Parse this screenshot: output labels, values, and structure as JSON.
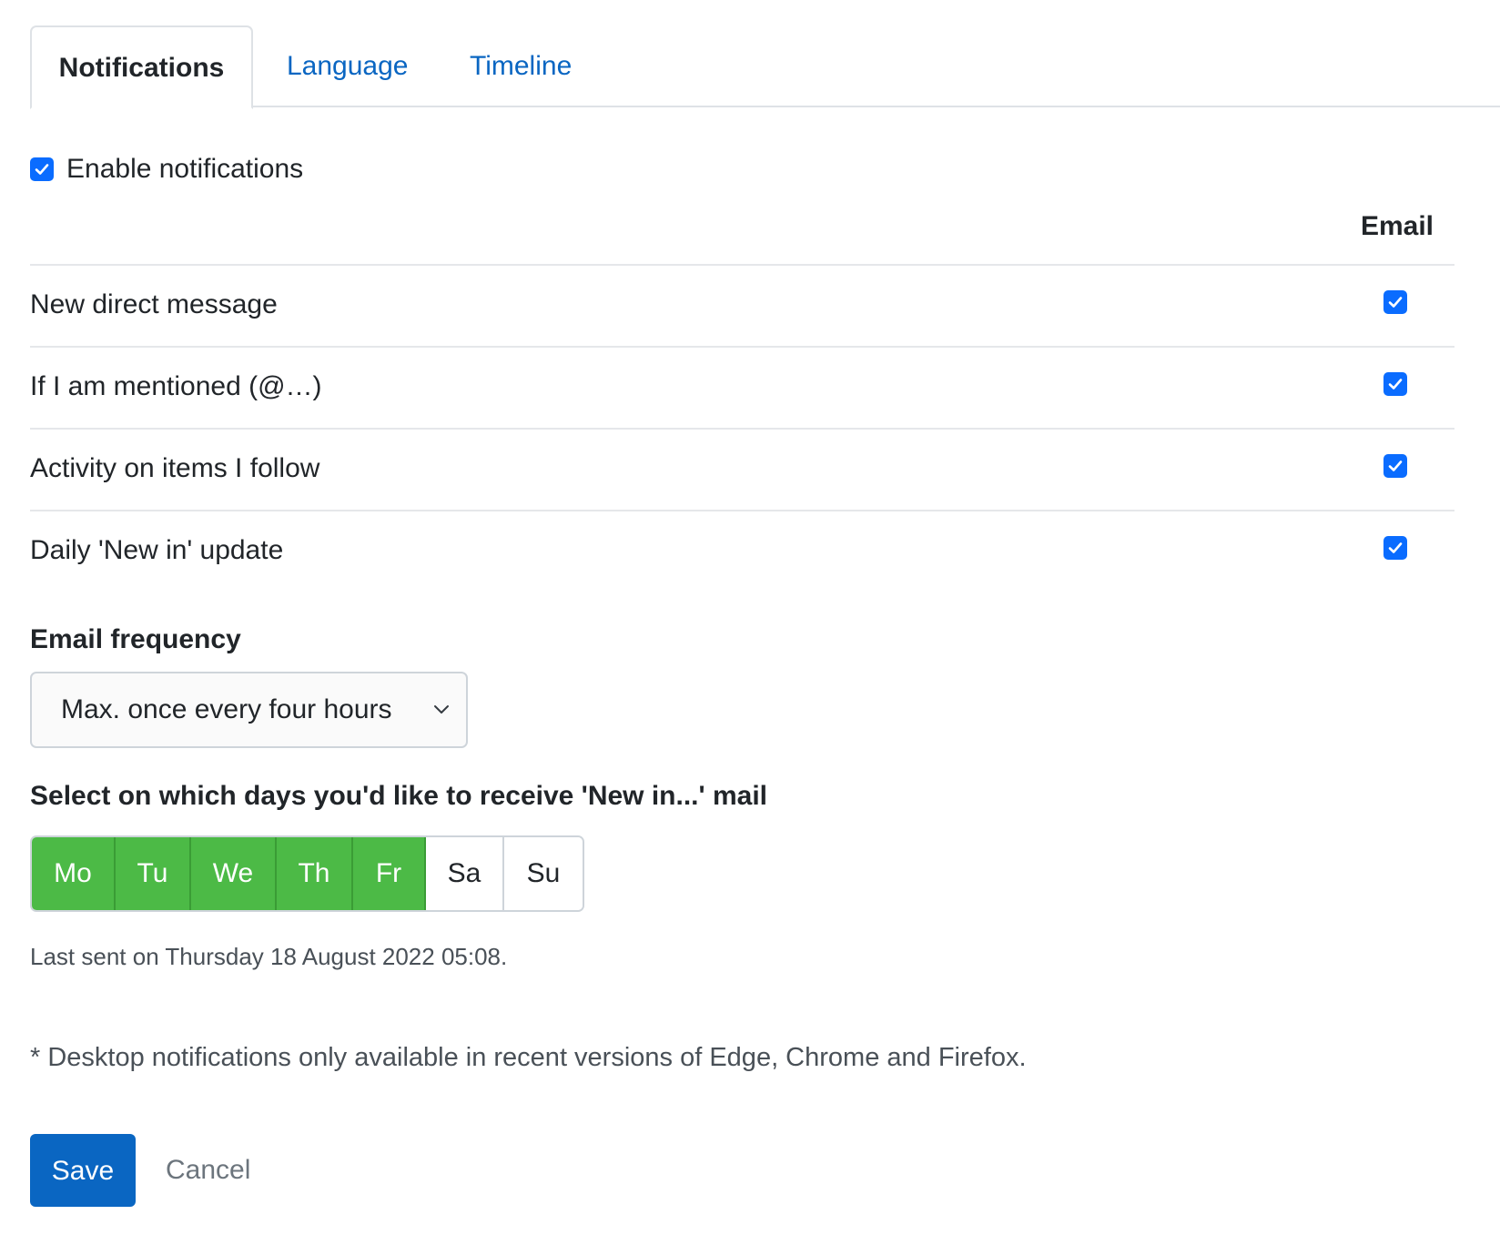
{
  "tabs": [
    {
      "label": "Notifications",
      "active": true
    },
    {
      "label": "Language",
      "active": false
    },
    {
      "label": "Timeline",
      "active": false
    }
  ],
  "enable_notifications": {
    "label": "Enable notifications",
    "checked": true
  },
  "table": {
    "column_header": "Email",
    "rows": [
      {
        "label": "New direct message",
        "email": true
      },
      {
        "label": "If I am mentioned (@…)",
        "email": true
      },
      {
        "label": "Activity on items I follow",
        "email": true
      },
      {
        "label": "Daily 'New in' update",
        "email": true
      }
    ]
  },
  "frequency": {
    "label": "Email frequency",
    "selected": "Max. once every four hours"
  },
  "days": {
    "label": "Select on which days you'd like to receive 'New in...' mail",
    "items": [
      {
        "label": "Mo",
        "selected": true
      },
      {
        "label": "Tu",
        "selected": true
      },
      {
        "label": "We",
        "selected": true
      },
      {
        "label": "Th",
        "selected": true
      },
      {
        "label": "Fr",
        "selected": true
      },
      {
        "label": "Sa",
        "selected": false
      },
      {
        "label": "Su",
        "selected": false
      }
    ]
  },
  "last_sent": "Last sent on Thursday 18 August 2022 05:08.",
  "footnote": "* Desktop notifications only available in recent versions of Edge, Chrome and Firefox.",
  "actions": {
    "save_label": "Save",
    "cancel_label": "Cancel"
  },
  "colors": {
    "accent": "#0a66c2",
    "checkbox": "#0a6cff",
    "day_selected": "#4cba46"
  },
  "icons": {
    "checkbox": "checkmark-icon",
    "select": "chevron-down-icon"
  }
}
